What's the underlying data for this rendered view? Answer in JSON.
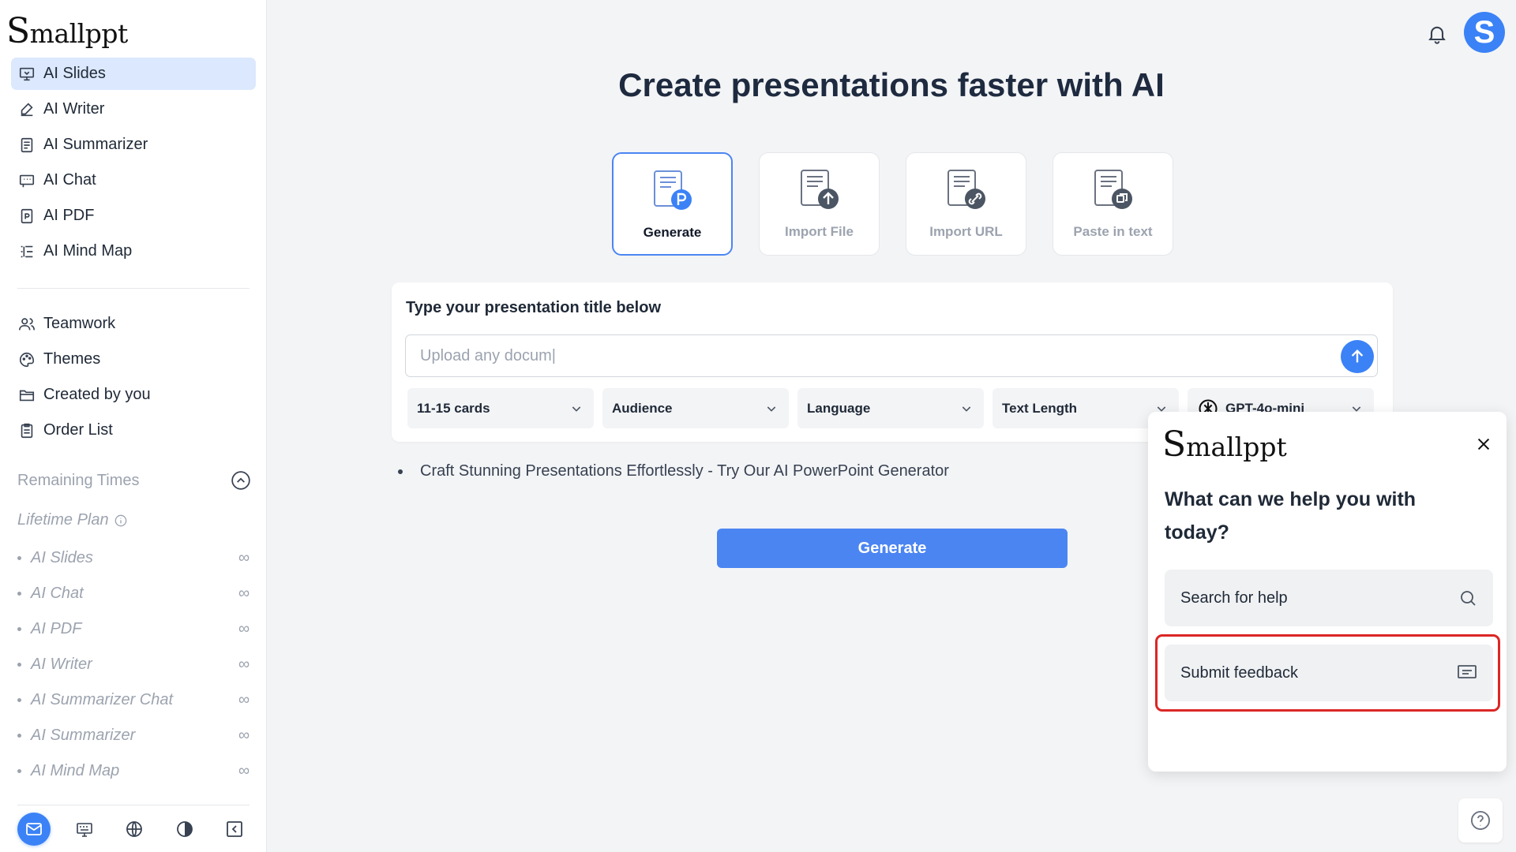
{
  "app": {
    "logo": "Smallppt",
    "logo_initial": "S",
    "logo_rest": "mallppt"
  },
  "sidebar": {
    "nav_primary": [
      {
        "label": "AI Slides",
        "icon": "presentation-icon",
        "active": true
      },
      {
        "label": "AI Writer",
        "icon": "pen-icon"
      },
      {
        "label": "AI Summarizer",
        "icon": "document-icon"
      },
      {
        "label": "AI Chat",
        "icon": "chat-icon"
      },
      {
        "label": "AI PDF",
        "icon": "pdf-icon"
      },
      {
        "label": "AI Mind Map",
        "icon": "mindmap-icon"
      }
    ],
    "nav_secondary": [
      {
        "label": "Teamwork",
        "icon": "users-icon"
      },
      {
        "label": "Themes",
        "icon": "palette-icon"
      },
      {
        "label": "Created by you",
        "icon": "folder-icon"
      },
      {
        "label": "Order List",
        "icon": "clipboard-icon"
      }
    ],
    "remaining_label": "Remaining Times",
    "plan_label": "Lifetime Plan",
    "quotas": [
      {
        "label": "AI Slides",
        "value": "∞"
      },
      {
        "label": "AI Chat",
        "value": "∞"
      },
      {
        "label": "AI PDF",
        "value": "∞"
      },
      {
        "label": "AI Writer",
        "value": "∞"
      },
      {
        "label": "AI Summarizer Chat",
        "value": "∞"
      },
      {
        "label": "AI Summarizer",
        "value": "∞"
      },
      {
        "label": "AI Mind Map",
        "value": "∞"
      }
    ]
  },
  "header": {
    "avatar_letter": "S"
  },
  "main": {
    "title": "Create presentations faster with AI",
    "modes": [
      {
        "label": "Generate",
        "active": true
      },
      {
        "label": "Import File"
      },
      {
        "label": "Import URL"
      },
      {
        "label": "Paste in text"
      }
    ],
    "card_title": "Type your presentation title below",
    "input_placeholder": "Upload any docum|",
    "selects": [
      {
        "value": "11-15 cards"
      },
      {
        "value": "Audience"
      },
      {
        "value": "Language"
      },
      {
        "value": "Text Length"
      },
      {
        "value": "GPT-4o-mini"
      }
    ],
    "tip": "Craft Stunning Presentations Effortlessly - Try Our AI PowerPoint Generator",
    "generate_label": "Generate"
  },
  "help": {
    "logo": "Smallppt",
    "question": "What can we help you with today?",
    "search_label": "Search for help",
    "feedback_label": "Submit feedback"
  },
  "colors": {
    "accent": "#3b82f6",
    "active_bg": "#dbe8fd",
    "highlight": "#dc2626"
  }
}
